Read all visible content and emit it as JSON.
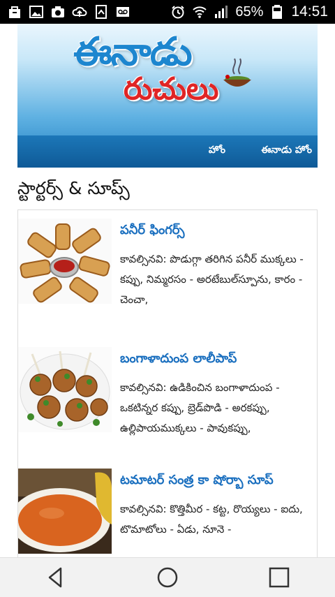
{
  "status_bar": {
    "battery_percent": "65%",
    "time": "14:51",
    "left_icons": [
      "bag-icon",
      "image-icon",
      "camera-icon",
      "cloud-upload-icon",
      "mobile-data-icon",
      "voicemail-icon"
    ],
    "right_icons": [
      "alarm-icon",
      "wifi-icon",
      "signal-icon",
      "battery-icon"
    ]
  },
  "header": {
    "logo_title": "ఈనాడు",
    "logo_subtitle": "రుచులు",
    "nav": {
      "home": "హోం",
      "eenadu_home": "ఈనాడు హోం"
    }
  },
  "section": {
    "title": "స్టార్టర్స్ & సూప్స్"
  },
  "recipes": [
    {
      "title": "పనీర్ ఫింగర్స్",
      "description": "కావల్సినవి: పొడుగ్గా తరిగిన పనీర్ ముక్కలు - కప్పు, నిమ్మరసం - అరటేబుల్‌స్పూను, కారం - చెంచా,",
      "image": "paneer-fingers"
    },
    {
      "title": "బంగాళాదుంప లాలీపాప్",
      "description": "కావల్సినవి: ఉడికించిన బంగాళాదుంప - ఒకటిన్నర కప్పు, బ్రెడ్‌పొడి - అరకప్పు, ఉల్లిపాయముక్కలు - పావుకప్పు,",
      "image": "potato-lollipop"
    },
    {
      "title": "టమాటర్ సంత్ర కా షోర్బా సూప్",
      "description": "కావల్సినవి: కొత్తిమీర - కట్ట, రొయ్యలు - ఐదు, టొమాటోలు - ఏడు, నూనె -",
      "image": "tomato-soup"
    }
  ],
  "bottom_nav": {
    "back": "back-icon",
    "home": "home-icon",
    "recents": "recents-icon"
  },
  "colors": {
    "header_blue": "#1c77b8",
    "title_blue": "#1a6fbf",
    "logo_red": "#e02525"
  }
}
